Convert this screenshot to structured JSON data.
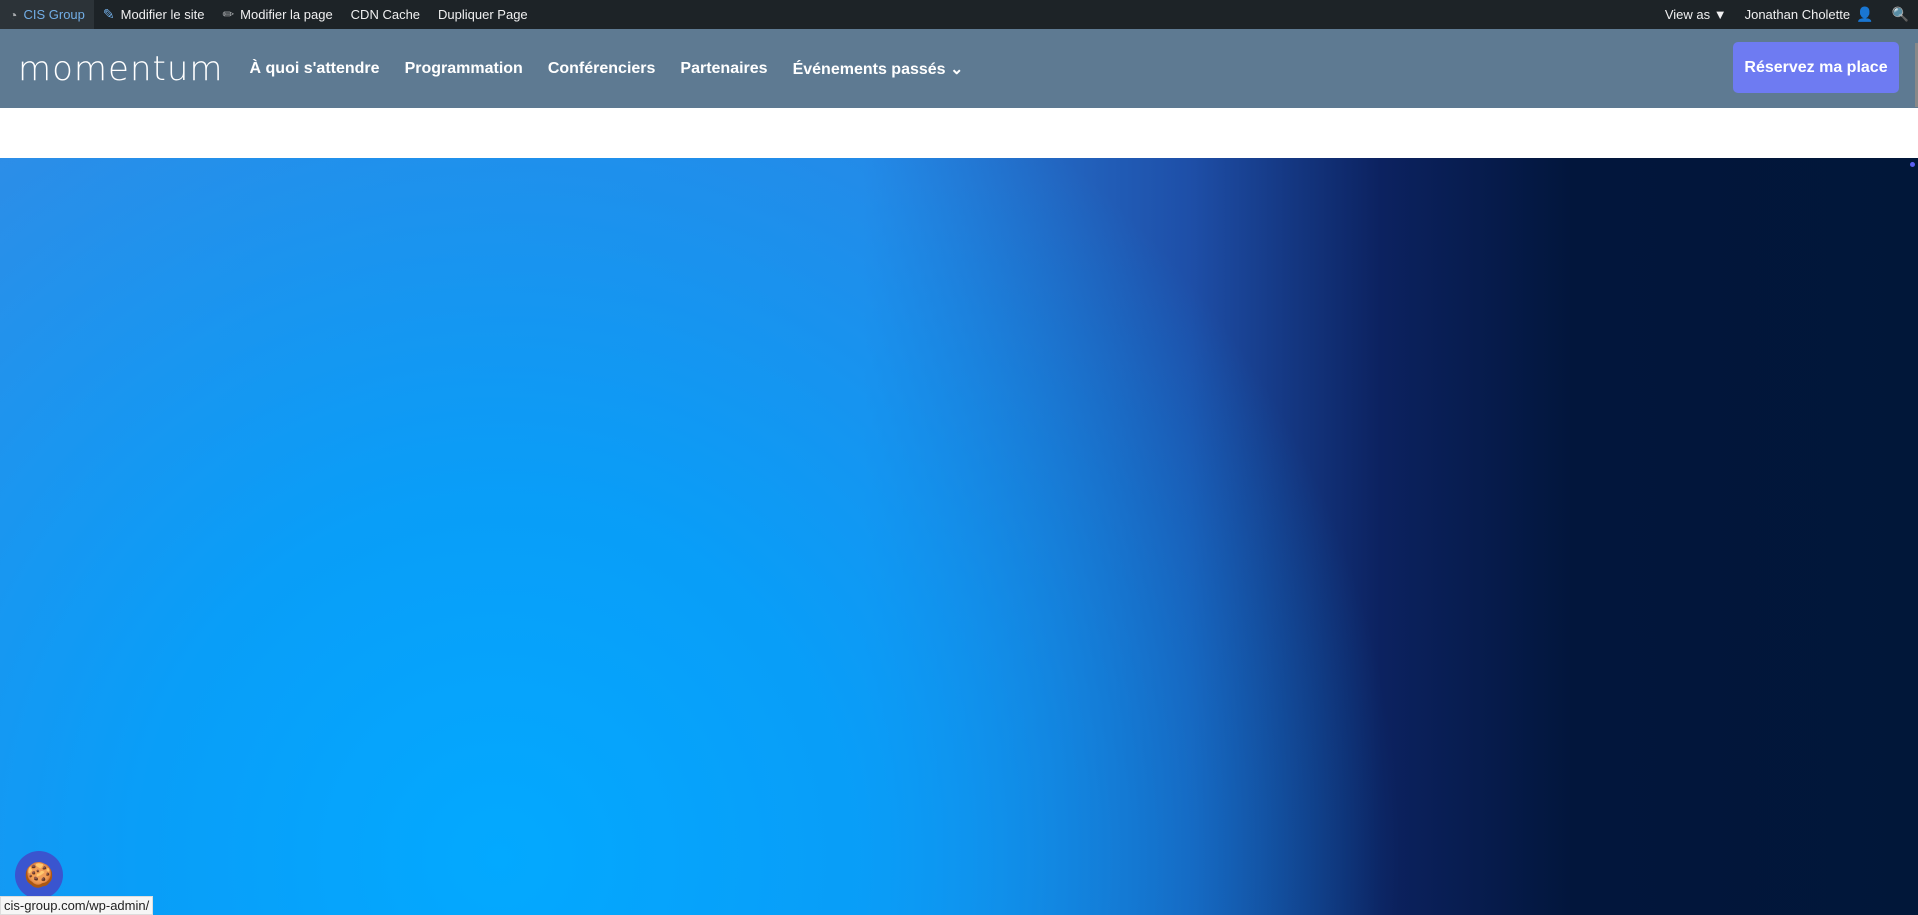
{
  "adminbar": {
    "site": "CIS Group",
    "edit_site": "Modifier le site",
    "edit_page": "Modifier la page",
    "cdn": "CDN Cache",
    "duplicate": "Dupliquer Page",
    "view_as": "View as ▼",
    "user": "Jonathan Cholette"
  },
  "nav": {
    "logo": "momentum",
    "links": [
      "À quoi s'attendre",
      "Programmation",
      "Conférenciers",
      "Partenaires",
      "Événements passés ⌄"
    ],
    "cta": "Réservez ma place"
  },
  "status_url": "cis-group.com/wp-admin/"
}
